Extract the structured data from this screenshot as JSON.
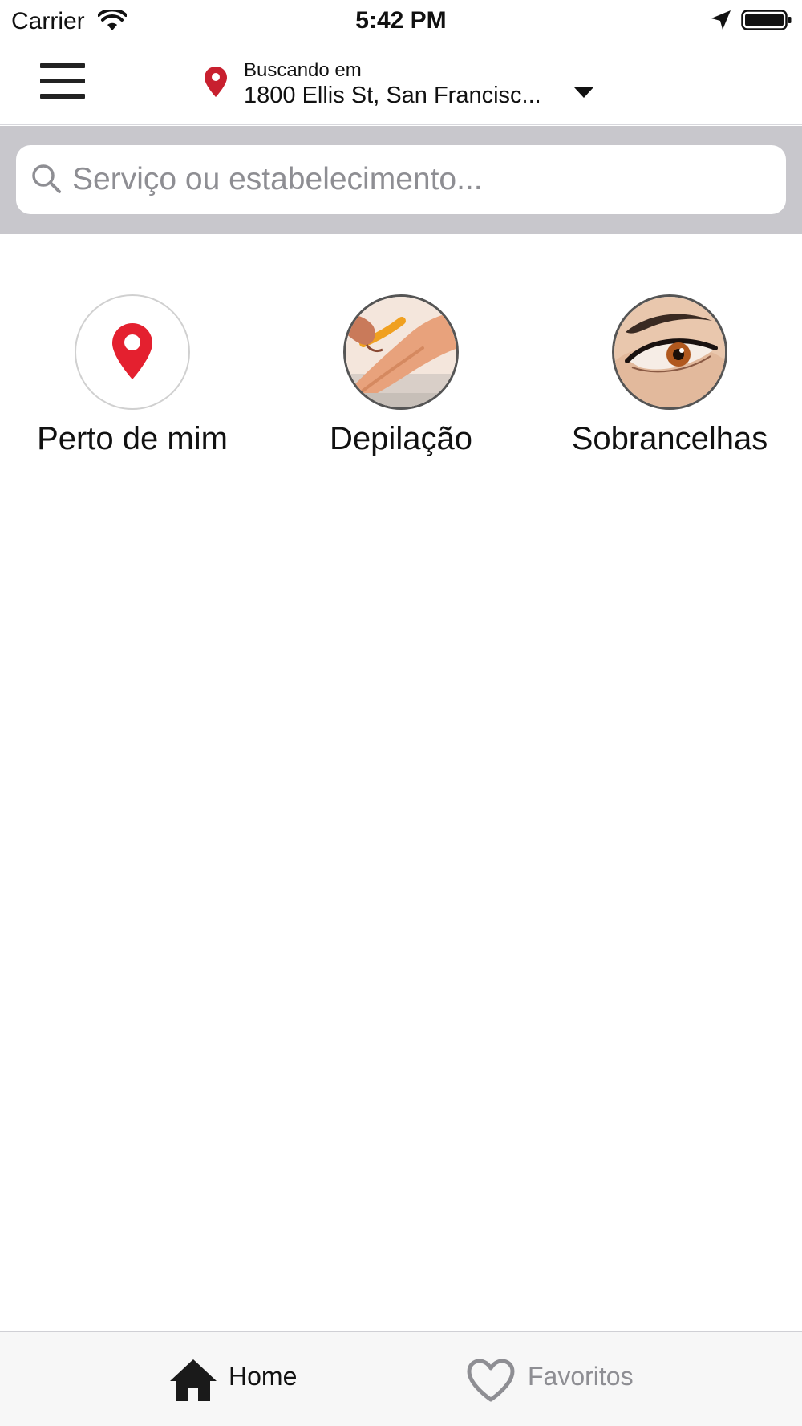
{
  "status_bar": {
    "carrier": "Carrier",
    "time": "5:42 PM",
    "icons": [
      "wifi-icon",
      "location-arrow-icon",
      "battery-icon"
    ]
  },
  "header": {
    "menu_icon": "hamburger-menu-icon",
    "searching_label": "Buscando em",
    "location_value": "1800 Ellis St, San Francisc...",
    "pin_color": "#c8202f",
    "dropdown_icon": "triangle-down-icon"
  },
  "search": {
    "placeholder": "Serviço ou estabelecimento...",
    "value": "",
    "icon": "search-icon",
    "band_color": "#c8c7cc"
  },
  "categories": [
    {
      "label": "Perto de mim",
      "icon": "map-pin-icon",
      "icon_color": "#e4202f"
    },
    {
      "label": "Depilação",
      "icon": "waxing-photo"
    },
    {
      "label": "Sobrancelhas",
      "icon": "eyebrow-photo"
    }
  ],
  "tab_bar": {
    "tabs": [
      {
        "label": "Home",
        "icon": "home-icon",
        "active": true
      },
      {
        "label": "Favoritos",
        "icon": "heart-icon",
        "active": false
      }
    ],
    "active_color": "#111111",
    "inactive_color": "#8e8e93"
  }
}
